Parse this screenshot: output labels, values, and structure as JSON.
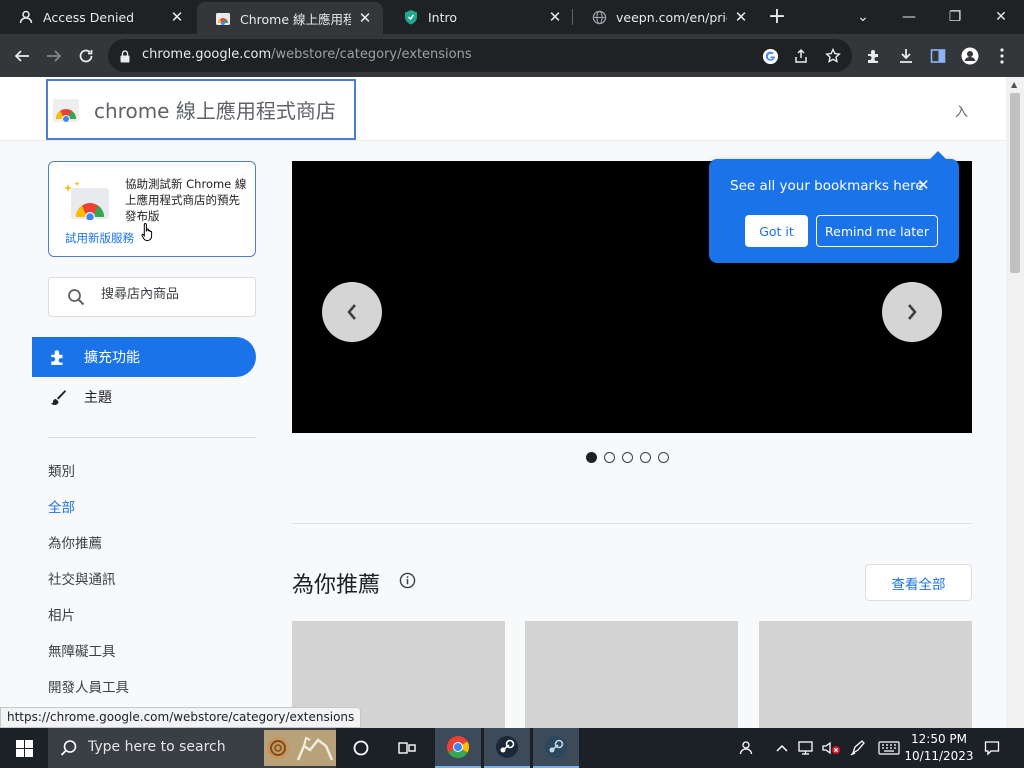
{
  "browser": {
    "tabs": [
      {
        "title": "Access Denied",
        "close": "✕"
      },
      {
        "title": "Chrome 線上應用程式商店 - 擴充功能",
        "close": "✕"
      },
      {
        "title": "Intro",
        "close": "✕"
      },
      {
        "title": "veepn.com/en/pricing",
        "close": "✕"
      }
    ],
    "new_tab": "+",
    "window_controls": {
      "tab_search": "⌄",
      "minimize": "—",
      "restore": "❐",
      "close": "✕"
    },
    "url_host": "chrome.google.com",
    "url_path": "/webstore/category/extensions",
    "status_url": "https://chrome.google.com/webstore/category/extensions"
  },
  "header": {
    "store_title": "chrome 線上應用程式商店",
    "signin_partial": "入"
  },
  "promo": {
    "text": "協助測試新 Chrome 線上應用程式商店的預先發布版",
    "link": "試用新版服務"
  },
  "search": {
    "placeholder": "搜尋店內商品"
  },
  "nav": {
    "extensions": "擴充功能",
    "themes": "主題"
  },
  "categories": {
    "heading": "類別",
    "items": [
      "全部",
      "為你推薦",
      "社交與通訊",
      "相片",
      "無障礙工具",
      "開發人員工具"
    ]
  },
  "carousel": {
    "prev": "‹",
    "next": "›",
    "slides": 5,
    "active_slide": 1
  },
  "recommended": {
    "title": "為你推薦",
    "see_all": "查看全部"
  },
  "bookmark_bubble": {
    "message": "See all your bookmarks here",
    "got_it": "Got it",
    "remind": "Remind me later",
    "close": "✕"
  },
  "taskbar": {
    "search_placeholder": "Type here to search",
    "time": "12:50 PM",
    "date": "10/11/2023"
  },
  "colors": {
    "accent": "#1a73e8",
    "tab_bg": "#202124",
    "toolbar_bg": "#35363a",
    "page_bg": "#f8f9fa"
  }
}
